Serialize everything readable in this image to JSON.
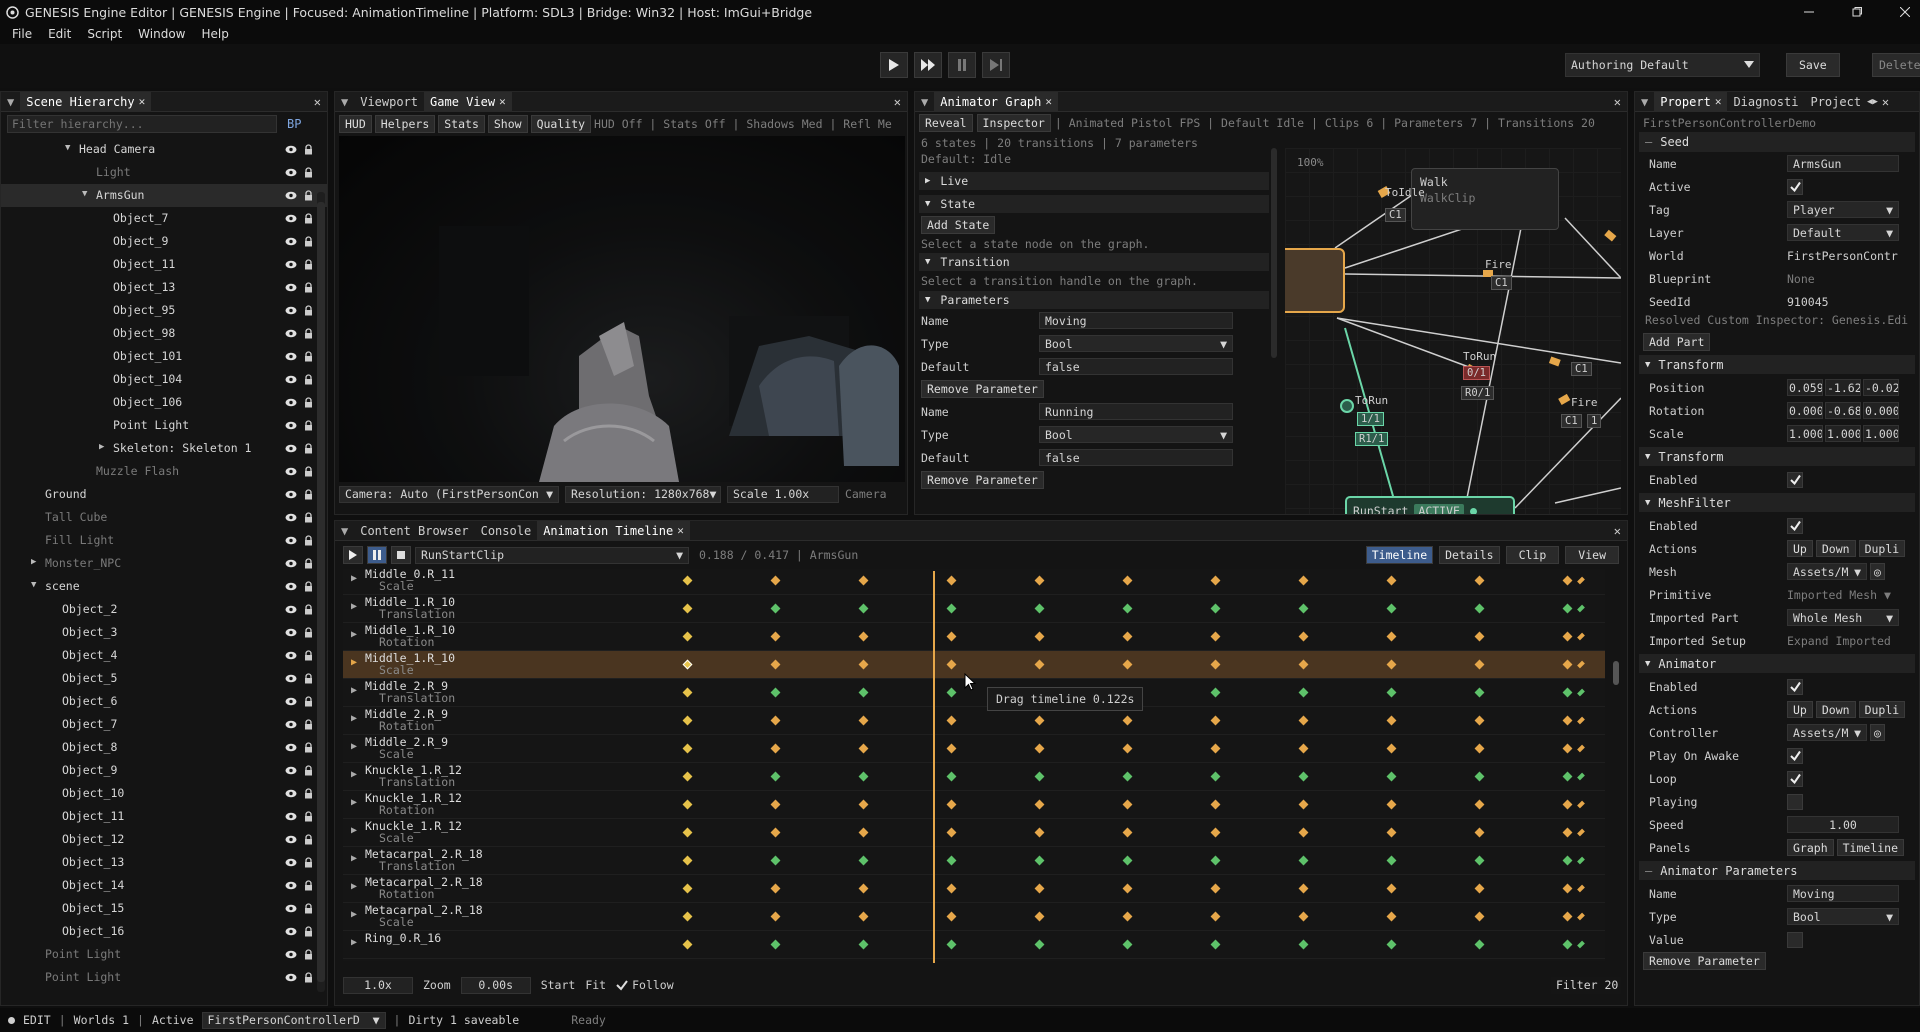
{
  "window": {
    "title": "GENESIS Engine Editor | GENESIS Engine | Focused: AnimationTimeline | Platform: SDL3 | Bridge: Win32 | Host: ImGui+Bridge"
  },
  "menu": [
    "File",
    "Edit",
    "Script",
    "Window",
    "Help"
  ],
  "toolbar": {
    "layout": "Authoring Default",
    "save": "Save",
    "delete": "Delete"
  },
  "hierarchy": {
    "tab": "Scene Hierarchy",
    "filter_placeholder": "Filter hierarchy...",
    "bp": "BP",
    "items": [
      {
        "label": "Head Camera",
        "depth": 3,
        "expanded": true,
        "dim": false
      },
      {
        "label": "Light",
        "depth": 4,
        "expanded": null,
        "dim": true
      },
      {
        "label": "ArmsGun",
        "depth": 4,
        "expanded": true,
        "dim": false,
        "selected": true
      },
      {
        "label": "Object_7",
        "depth": 5,
        "expanded": null,
        "dim": false
      },
      {
        "label": "Object_9",
        "depth": 5,
        "expanded": null,
        "dim": false
      },
      {
        "label": "Object_11",
        "depth": 5,
        "expanded": null,
        "dim": false
      },
      {
        "label": "Object_13",
        "depth": 5,
        "expanded": null,
        "dim": false
      },
      {
        "label": "Object_95",
        "depth": 5,
        "expanded": null,
        "dim": false
      },
      {
        "label": "Object_98",
        "depth": 5,
        "expanded": null,
        "dim": false
      },
      {
        "label": "Object_101",
        "depth": 5,
        "expanded": null,
        "dim": false
      },
      {
        "label": "Object_104",
        "depth": 5,
        "expanded": null,
        "dim": false
      },
      {
        "label": "Object_106",
        "depth": 5,
        "expanded": null,
        "dim": false
      },
      {
        "label": "Point Light",
        "depth": 5,
        "expanded": null,
        "dim": false
      },
      {
        "label": "Skeleton: Skeleton 1",
        "depth": 5,
        "expanded": false,
        "dim": false
      },
      {
        "label": "Muzzle Flash",
        "depth": 4,
        "expanded": null,
        "dim": true
      },
      {
        "label": "Ground",
        "depth": 1,
        "expanded": null,
        "dim": false
      },
      {
        "label": "Tall Cube",
        "depth": 1,
        "expanded": null,
        "dim": true
      },
      {
        "label": "Fill Light",
        "depth": 1,
        "expanded": null,
        "dim": true
      },
      {
        "label": "Monster_NPC",
        "depth": 1,
        "expanded": false,
        "dim": true
      },
      {
        "label": "scene",
        "depth": 1,
        "expanded": true,
        "dim": false
      },
      {
        "label": "Object_2",
        "depth": 2,
        "expanded": null,
        "dim": false
      },
      {
        "label": "Object_3",
        "depth": 2,
        "expanded": null,
        "dim": false
      },
      {
        "label": "Object_4",
        "depth": 2,
        "expanded": null,
        "dim": false
      },
      {
        "label": "Object_5",
        "depth": 2,
        "expanded": null,
        "dim": false
      },
      {
        "label": "Object_6",
        "depth": 2,
        "expanded": null,
        "dim": false
      },
      {
        "label": "Object_7",
        "depth": 2,
        "expanded": null,
        "dim": false
      },
      {
        "label": "Object_8",
        "depth": 2,
        "expanded": null,
        "dim": false
      },
      {
        "label": "Object_9",
        "depth": 2,
        "expanded": null,
        "dim": false
      },
      {
        "label": "Object_10",
        "depth": 2,
        "expanded": null,
        "dim": false
      },
      {
        "label": "Object_11",
        "depth": 2,
        "expanded": null,
        "dim": false
      },
      {
        "label": "Object_12",
        "depth": 2,
        "expanded": null,
        "dim": false
      },
      {
        "label": "Object_13",
        "depth": 2,
        "expanded": null,
        "dim": false
      },
      {
        "label": "Object_14",
        "depth": 2,
        "expanded": null,
        "dim": false
      },
      {
        "label": "Object_15",
        "depth": 2,
        "expanded": null,
        "dim": false
      },
      {
        "label": "Object_16",
        "depth": 2,
        "expanded": null,
        "dim": false
      },
      {
        "label": "Point Light",
        "depth": 1,
        "expanded": null,
        "dim": true
      },
      {
        "label": "Point Light",
        "depth": 1,
        "expanded": null,
        "dim": true
      }
    ]
  },
  "viewport": {
    "tabs": [
      "Viewport",
      "Game View"
    ],
    "toolbar_buttons": [
      "HUD",
      "Helpers",
      "Stats",
      "Show",
      "Quality"
    ],
    "toolbar_status": "HUD Off | Stats Off | Shadows Med | Refl Me",
    "camera": "Camera: Auto (FirstPersonCon",
    "resolution": "Resolution: 1280x768",
    "scale_label": "Scale",
    "scale_value": "1.00x",
    "camera_btn": "Camera"
  },
  "animator": {
    "tab": "Animator Graph",
    "buttons": [
      "Reveal",
      "Inspector"
    ],
    "summary": "| Animated Pistol FPS | Default Idle | Clips 6 | Parameters 7 | Transitions 20",
    "stats": "6 states | 20 transitions | 7 parameters",
    "default": "Default: Idle",
    "sections": {
      "live": "Live",
      "state": "State",
      "transition": "Transition",
      "parameters": "Parameters"
    },
    "add_state": "Add State",
    "state_hint": "Select a state node on the graph.",
    "transition_hint": "Select a transition handle on the graph.",
    "param_labels": {
      "name": "Name",
      "type": "Type",
      "default": "Default"
    },
    "remove_param": "Remove Parameter",
    "params": [
      {
        "name": "Moving",
        "type": "Bool",
        "default": "false"
      },
      {
        "name": "Running",
        "type": "Bool",
        "default": "false"
      }
    ],
    "graph": {
      "zoom": "100%",
      "walk_title": "Walk",
      "walk_clip": "WalkClip",
      "runstart": "RunStart",
      "active": "ACTIVE",
      "labels": {
        "toidle": "ToIdle",
        "fire1": "Fire",
        "torun1": "ToRun",
        "torun2": "ToRun",
        "fire2": "Fire",
        "c1a": "C1",
        "c1b": "C1",
        "c1c": "C1",
        "c1d": "C1",
        "one": "1",
        "r01a": "0/1",
        "r01b": "R0/1",
        "g11": "1/1",
        "r11": "R1/1"
      }
    }
  },
  "bottom": {
    "tabs": [
      "Content Browser",
      "Console",
      "Animation Timeline"
    ],
    "clip": "RunStartClip",
    "time": "0.188 / 0.417 | ArmsGun",
    "view_tabs": [
      "Timeline",
      "Details",
      "Clip",
      "View"
    ],
    "tooltip": "Drag timeline 0.122s",
    "tracks": [
      {
        "name": "Middle_0.R_11",
        "sub": "Scale",
        "color": "#e6a74a"
      },
      {
        "name": "Middle_1.R_10",
        "sub": "Translation",
        "color": "#5ec26a"
      },
      {
        "name": "Middle_1.R_10",
        "sub": "Rotation",
        "color": "#e6a74a"
      },
      {
        "name": "Middle_1.R_10",
        "sub": "Scale",
        "color": "#e6a74a",
        "selected": true
      },
      {
        "name": "Middle_2.R_9",
        "sub": "Translation",
        "color": "#5ec26a"
      },
      {
        "name": "Middle_2.R_9",
        "sub": "Rotation",
        "color": "#e6a74a"
      },
      {
        "name": "Middle_2.R_9",
        "sub": "Scale",
        "color": "#e6a74a"
      },
      {
        "name": "Knuckle_1.R_12",
        "sub": "Translation",
        "color": "#5ec26a"
      },
      {
        "name": "Knuckle_1.R_12",
        "sub": "Rotation",
        "color": "#e6a74a"
      },
      {
        "name": "Knuckle_1.R_12",
        "sub": "Scale",
        "color": "#e6a74a"
      },
      {
        "name": "Metacarpal_2.R_18",
        "sub": "Translation",
        "color": "#5ec26a"
      },
      {
        "name": "Metacarpal_2.R_18",
        "sub": "Rotation",
        "color": "#e6a74a"
      },
      {
        "name": "Metacarpal_2.R_18",
        "sub": "Scale",
        "color": "#e6a74a"
      },
      {
        "name": "Ring_0.R_16",
        "sub": "",
        "color": "#5ec26a"
      }
    ],
    "footer": {
      "speed": "1.0x",
      "zoom": "Zoom",
      "zoom_val": "0.00s",
      "start": "Start",
      "fit": "Fit",
      "follow": "Follow",
      "filter": "Filter 20"
    }
  },
  "inspector": {
    "tabs": [
      "Propert",
      "Diagnosti",
      "Project"
    ],
    "object": "FirstPersonControllerDemo",
    "seed_header": "Seed",
    "rows": {
      "name": {
        "label": "Name",
        "value": "ArmsGun"
      },
      "active": {
        "label": "Active"
      },
      "tag": {
        "label": "Tag",
        "value": "Player"
      },
      "layer": {
        "label": "Layer",
        "value": "Default"
      },
      "world": {
        "label": "World",
        "value": "FirstPersonContr"
      },
      "blueprint": {
        "label": "Blueprint",
        "value": "None"
      },
      "seedid": {
        "label": "SeedId",
        "value": "910045"
      }
    },
    "resolved": "Resolved Custom Inspector: Genesis.Edi",
    "add_part": "Add Part",
    "transform_header": "Transform",
    "position": {
      "label": "Position",
      "x": "0.059",
      "y": "-1.62",
      "z": "-0.02"
    },
    "rotation": {
      "label": "Rotation",
      "x": "0.000",
      "y": "-0.68",
      "z": "0.000"
    },
    "scale": {
      "label": "Scale",
      "x": "1.000",
      "y": "1.000",
      "z": "1.000"
    },
    "transform2_header": "Transform",
    "enabled": "Enabled",
    "meshfilter_header": "MeshFilter",
    "actions": "Actions",
    "up": "Up",
    "down": "Down",
    "dupli": "Dupli",
    "mesh": {
      "label": "Mesh",
      "value": "Assets/M"
    },
    "primitive": {
      "label": "Primitive",
      "value": "Imported Mesh"
    },
    "imported_part": {
      "label": "Imported Part",
      "value": "Whole Mesh"
    },
    "imported_setup": {
      "label": "Imported Setup",
      "value": "Expand Imported"
    },
    "animator_header": "Animator",
    "controller": {
      "label": "Controller",
      "value": "Assets/M"
    },
    "play_on_awake": "Play On Awake",
    "loop": "Loop",
    "playing": "Playing",
    "speed": {
      "label": "Speed",
      "value": "1.00"
    },
    "panels": {
      "label": "Panels",
      "graph": "Graph",
      "timeline": "Timeline"
    },
    "anim_params_header": "Animator Parameters",
    "pname": {
      "label": "Name",
      "value": "Moving"
    },
    "ptype": {
      "label": "Type",
      "value": "Bool"
    },
    "pvalue": {
      "label": "Value"
    },
    "remove_param": "Remove Parameter"
  },
  "status": {
    "mode": "EDIT",
    "worlds": "Worlds 1",
    "active": "Active",
    "world": "FirstPersonControllerD",
    "dirty": "Dirty 1 saveable",
    "ready": "Ready"
  }
}
